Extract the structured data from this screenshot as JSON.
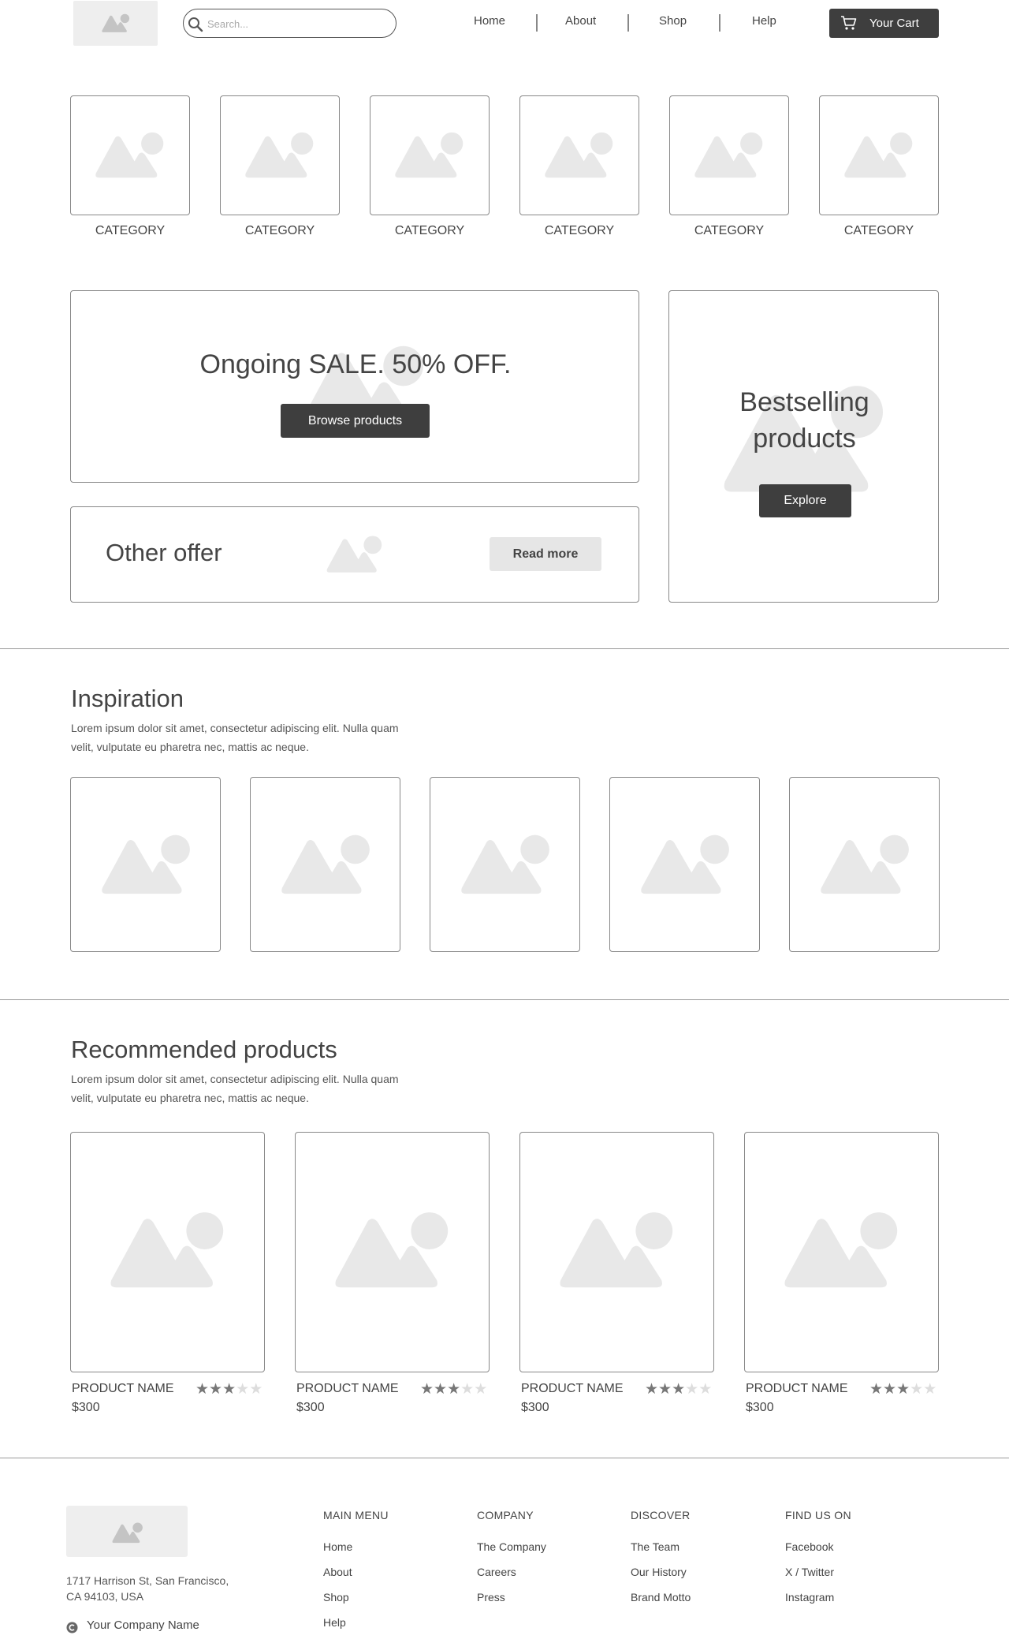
{
  "header": {
    "logo_icon": "image-placeholder-icon",
    "search_placeholder": "Search...",
    "search_icon": "search-icon",
    "nav": [
      "Home",
      "About",
      "Shop",
      "Help"
    ],
    "cart_label": "Your Cart",
    "cart_icon": "cart-icon"
  },
  "categories": [
    "CATEGORY",
    "CATEGORY",
    "CATEGORY",
    "CATEGORY",
    "CATEGORY",
    "CATEGORY"
  ],
  "promo": {
    "sale_title": "Ongoing SALE.  50% OFF.",
    "sale_button": "Browse products",
    "best_title_line1": "Bestselling",
    "best_title_line2": "products",
    "best_button": "Explore",
    "offer_title": "Other offer",
    "offer_button": "Read more"
  },
  "inspiration": {
    "title": "Inspiration",
    "description": "Lorem ipsum dolor sit amet, consectetur adipiscing elit. Nulla quam velit, vulputate eu pharetra nec, mattis ac neque."
  },
  "recommended": {
    "title": "Recommended products",
    "description": "Lorem ipsum dolor sit amet, consectetur adipiscing elit. Nulla quam velit, vulputate eu pharetra nec, mattis ac neque.",
    "products": [
      {
        "name": "PRODUCT NAME",
        "price": "$300",
        "rating": 3,
        "max_rating": 5
      },
      {
        "name": "PRODUCT NAME",
        "price": "$300",
        "rating": 3,
        "max_rating": 5
      },
      {
        "name": "PRODUCT NAME",
        "price": "$300",
        "rating": 3,
        "max_rating": 5
      },
      {
        "name": "PRODUCT NAME",
        "price": "$300",
        "rating": 3,
        "max_rating": 5
      }
    ]
  },
  "footer": {
    "address_line1": "1717 Harrison St, San Francisco,",
    "address_line2": "CA 94103, USA",
    "company_name": "Your Company Name",
    "columns": [
      {
        "heading": "MAIN MENU",
        "links": [
          "Home",
          "About",
          "Shop",
          "Help"
        ]
      },
      {
        "heading": "COMPANY",
        "links": [
          "The Company",
          "Careers",
          "Press"
        ]
      },
      {
        "heading": "DISCOVER",
        "links": [
          "The Team",
          "Our History",
          "Brand Motto"
        ]
      },
      {
        "heading": "FIND US ON",
        "links": [
          "Facebook",
          "X / Twitter",
          "Instagram"
        ]
      }
    ]
  },
  "colors": {
    "dark_button": "#3e3e3e",
    "placeholder_gray": "#e8e8e8",
    "border": "#888888",
    "text": "#444444"
  }
}
